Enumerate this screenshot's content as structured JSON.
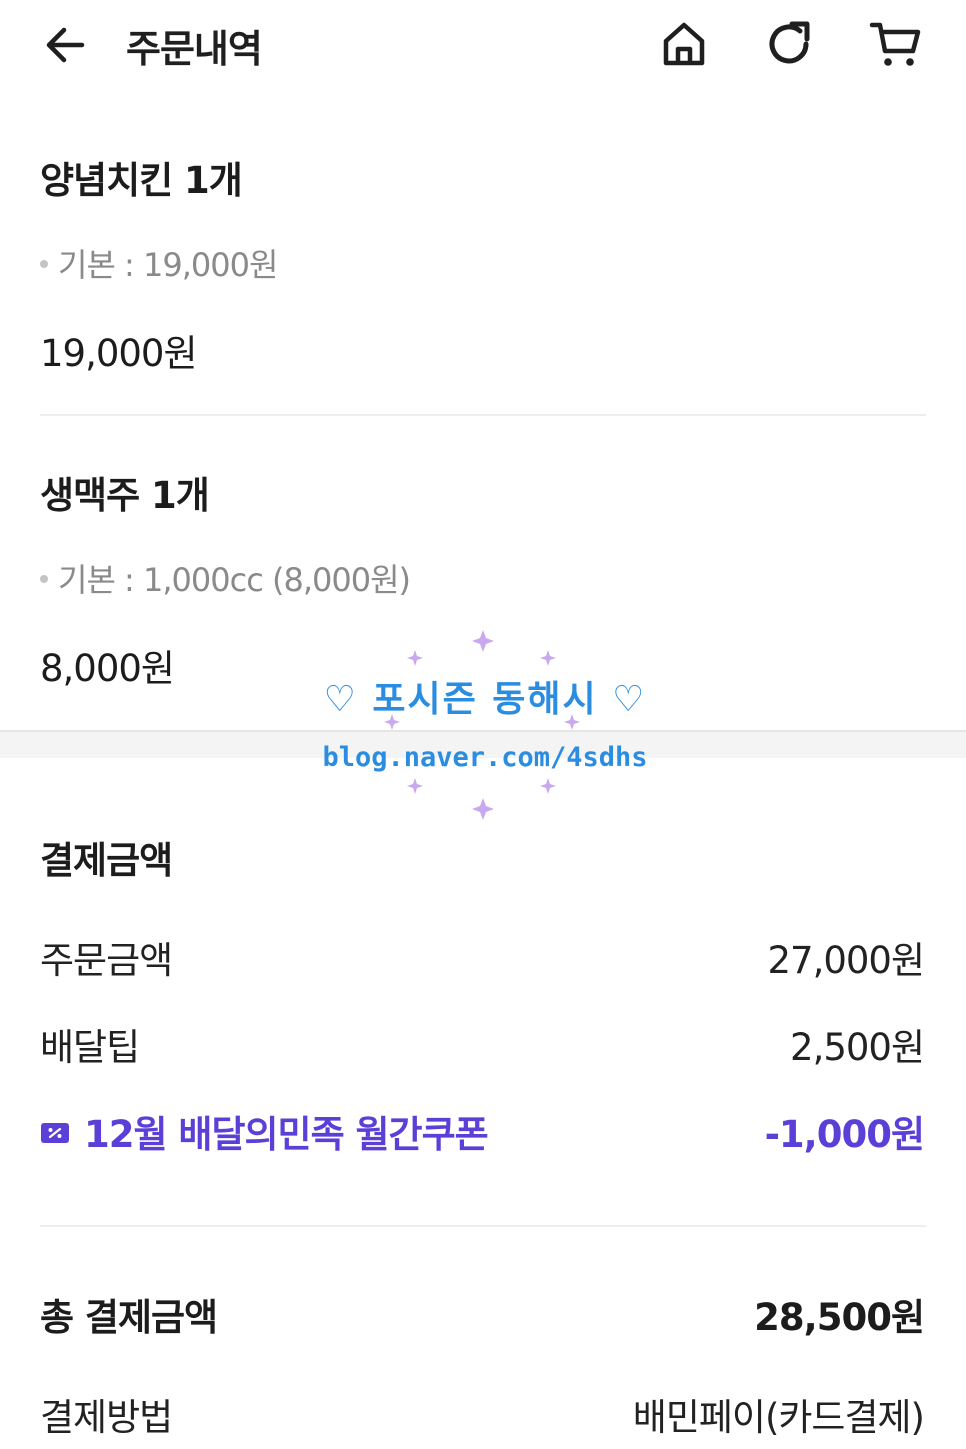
{
  "header": {
    "title": "주문내역",
    "icons": [
      "back-arrow-icon",
      "home-icon",
      "refresh-icon",
      "cart-icon"
    ]
  },
  "items": [
    {
      "name": "양념치킨 1개",
      "option": "기본 : 19,000원",
      "price": "19,000원"
    },
    {
      "name": "생맥주 1개",
      "option": "기본 : 1,000cc (8,000원)",
      "price": "8,000원"
    }
  ],
  "payment": {
    "title": "결제금액",
    "order_amount_label": "주문금액",
    "order_amount_value": "27,000원",
    "delivery_tip_label": "배달팁",
    "delivery_tip_value": "2,500원",
    "coupon_label": "12월 배달의민족 월간쿠폰",
    "coupon_value": "-1,000원",
    "total_label": "총 결제금액",
    "total_value": "28,500원",
    "method_label": "결제방법",
    "method_value": "배민페이(카드결제)"
  },
  "watermark": {
    "name": "♡ 포시즌 동해시 ♡",
    "url": "blog.naver.com/4sdhs"
  },
  "colors": {
    "accent": "#5b3fd6",
    "watermark": "#2b8de0",
    "text": "#222222",
    "muted": "#8a8a8a",
    "divider": "#eeeeee"
  }
}
